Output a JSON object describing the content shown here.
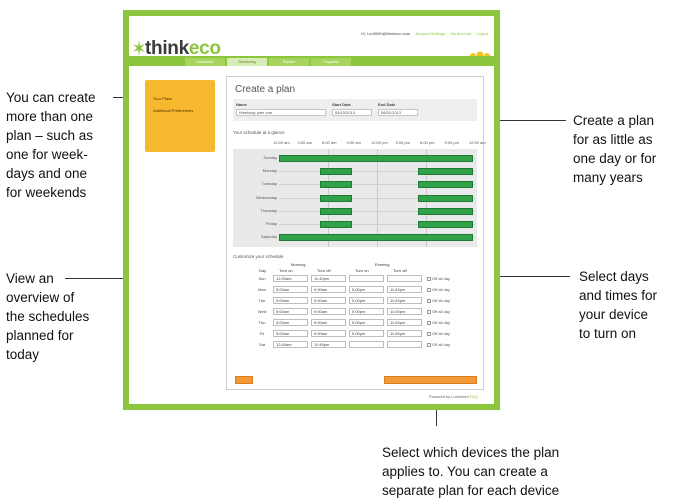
{
  "callouts": {
    "left_top": [
      "You can create",
      "more than one",
      "plan – such as",
      "one for week-",
      "days and one",
      "for weekends"
    ],
    "left_bottom": [
      "View an",
      "overview of",
      "the schedules",
      "planned for",
      "today"
    ],
    "right_top": [
      "Create a plan",
      "for as little as",
      "one day or for",
      "many years"
    ],
    "right_mid": [
      "Select days",
      "and times for",
      "your device",
      "to turn on"
    ],
    "bottom": [
      "Select which devices the plan",
      "applies to. You can create a",
      "separate plan for each device"
    ]
  },
  "app": {
    "logo_text": "think",
    "logo_accent": "eco",
    "header_user": "Hi, Lori3000@thinkeco.com",
    "header_links": [
      "Account Settings",
      "My Account",
      "Logout"
    ],
    "nav_tabs": [
      "Dashboard",
      "Scheduling",
      "Reports",
      "Programs"
    ],
    "sidebar_items": [
      "Your Plans",
      "Additional Preferences"
    ],
    "panel_title": "Create a plan",
    "form": {
      "name_label": "Name",
      "name_value": "Weekday plan one",
      "start_label": "Start Date",
      "start_value": "05/15/2013",
      "end_label": "End Date",
      "end_value": "08/31/2013"
    },
    "glance_title": "Your schedule at a glance",
    "glance_ticks": [
      "12:00 am",
      "3:00 am",
      "6:00 am",
      "9:00 am",
      "12:00 pm",
      "3:00 pm",
      "6:00 pm",
      "9:00 pm",
      "12:00 am"
    ],
    "glance_days": [
      "Sunday",
      "Monday",
      "Tuesday",
      "Wednesday",
      "Thursday",
      "Friday",
      "Saturday"
    ],
    "customize_title": "Customize your schedule",
    "table_headers": {
      "morning": "Morning",
      "evening": "Evening",
      "day": "Day",
      "turn_on": "Turn on",
      "turn_off": "Turn off",
      "turn_on2": "Turn on",
      "turn_off2": "Turn off"
    },
    "schedule_rows": [
      {
        "day": "Sun",
        "m_on": "12:00am",
        "m_off": "11:45pm",
        "e_on": "",
        "e_off": "",
        "off": "Off all day"
      },
      {
        "day": "Mon",
        "m_on": "5:00am",
        "m_off": "9:00am",
        "e_on": "5:00pm",
        "e_off": "11:45pm",
        "off": "Off all day"
      },
      {
        "day": "Tue",
        "m_on": "5:00am",
        "m_off": "9:00am",
        "e_on": "5:00pm",
        "e_off": "11:45pm",
        "off": "Off all day"
      },
      {
        "day": "Wed",
        "m_on": "5:00am",
        "m_off": "9:00am",
        "e_on": "5:00pm",
        "e_off": "11:45pm",
        "off": "Off all day"
      },
      {
        "day": "Thu",
        "m_on": "5:00am",
        "m_off": "9:00am",
        "e_on": "5:00pm",
        "e_off": "11:45pm",
        "off": "Off all day"
      },
      {
        "day": "Fri",
        "m_on": "5:00am",
        "m_off": "9:00am",
        "e_on": "5:00pm",
        "e_off": "11:45pm",
        "off": "Off all day"
      },
      {
        "day": "Sat",
        "m_on": "12:00am",
        "m_off": "11:45pm",
        "e_on": "",
        "e_off": "",
        "off": "Off all day"
      }
    ],
    "footer_text": "Powered by Lockheed",
    "footer_link": "FAQ",
    "colors": {
      "brand_green": "#8cc63f",
      "sidebar_yellow": "#f5b82e",
      "bar_green": "#2fa24a",
      "button_orange": "#f39a3a"
    }
  }
}
